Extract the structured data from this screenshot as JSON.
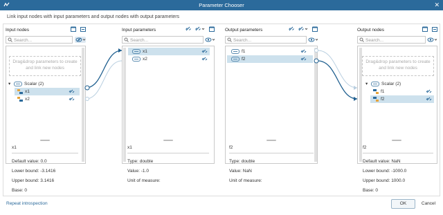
{
  "window": {
    "title": "Parameter Chooser",
    "close_glyph": "✕"
  },
  "subtitle": "Link input nodes with input parameters and output nodes with output parameters",
  "search_placeholder": "Search...",
  "drop_hint": "Drag&drop parameters to create and link new nodes",
  "input_nodes": {
    "title": "Input nodes",
    "group": "Scalar (2)",
    "items": [
      "x1",
      "x2"
    ],
    "detail": {
      "name": "x1",
      "lines": [
        "Default value: 0.0",
        "Lower bound: -3.1416",
        "Upper bound: 3.1416",
        "Base: 0"
      ]
    }
  },
  "input_parameters": {
    "title": "Input parameters",
    "items": [
      "x1",
      "x2"
    ],
    "detail": {
      "name": "x1",
      "lines": [
        "Type: double",
        "Value: -1.0",
        "Unit of measure:"
      ]
    }
  },
  "output_parameters": {
    "title": "Output parameters",
    "items": [
      "f1",
      "f2"
    ],
    "detail": {
      "name": "f2",
      "lines": [
        "Type: double",
        "Value: NaN",
        "Unit of measure:"
      ]
    }
  },
  "output_nodes": {
    "title": "Output nodes",
    "group": "Scalar (2)",
    "items": [
      "f1",
      "f2"
    ],
    "detail": {
      "name": "f2",
      "lines": [
        "Default value: NaN",
        "Lower bound: -1000.0",
        "Upper bound: 1000.0",
        "Base: 0"
      ]
    }
  },
  "footer": {
    "repeat": "Repeat introspection",
    "ok": "OK",
    "cancel": "Cancel"
  },
  "colors": {
    "titlebar": "#2b6a9b",
    "selection": "#cde1ed",
    "link_line": "#1f5f8f"
  }
}
